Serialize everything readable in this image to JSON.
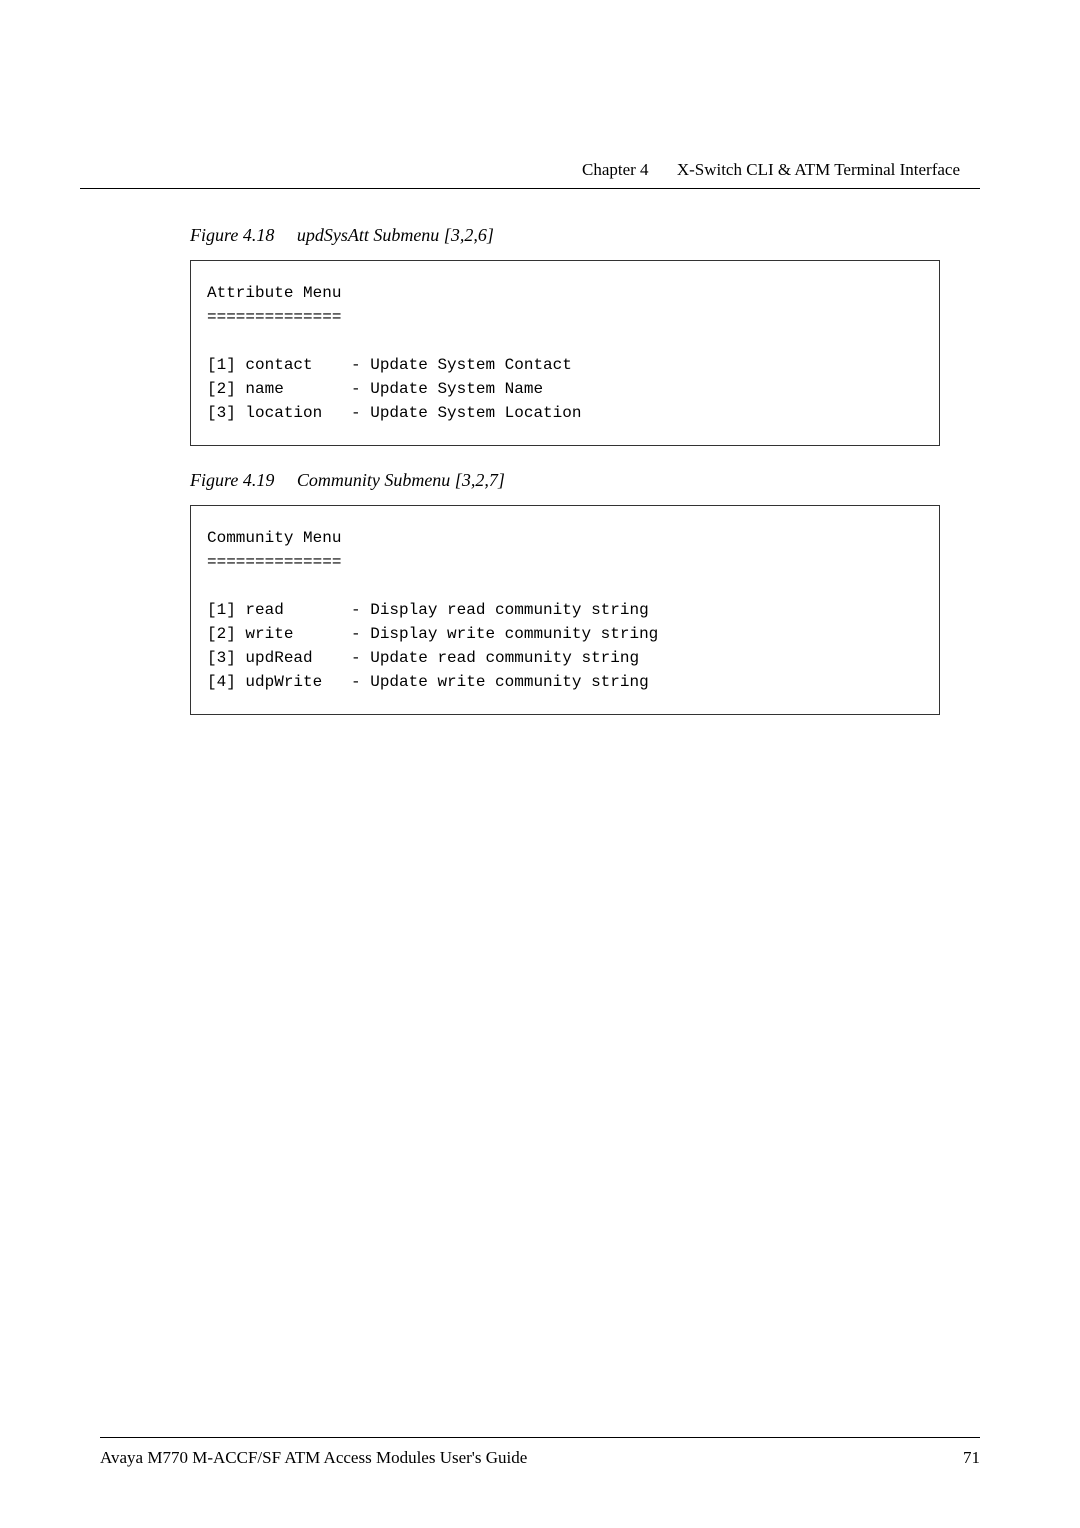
{
  "header": {
    "chapter": "Chapter 4",
    "title": "X-Switch CLI & ATM Terminal Interface"
  },
  "figure1": {
    "label": "Figure 4.18",
    "title": "updSysAtt Submenu [3,2,6]",
    "code": "Attribute Menu\n==============\n\n[1] contact    - Update System Contact\n[2] name       - Update System Name\n[3] location   - Update System Location"
  },
  "figure2": {
    "label": "Figure 4.19",
    "title": "Community Submenu [3,2,7]",
    "code": "Community Menu\n==============\n\n[1] read       - Display read community string\n[2] write      - Display write community string\n[3] updRead    - Update read community string\n[4] udpWrite   - Update write community string"
  },
  "footer": {
    "left": "Avaya M770 M-ACCF/SF ATM Access Modules User's Guide",
    "right": "71"
  }
}
